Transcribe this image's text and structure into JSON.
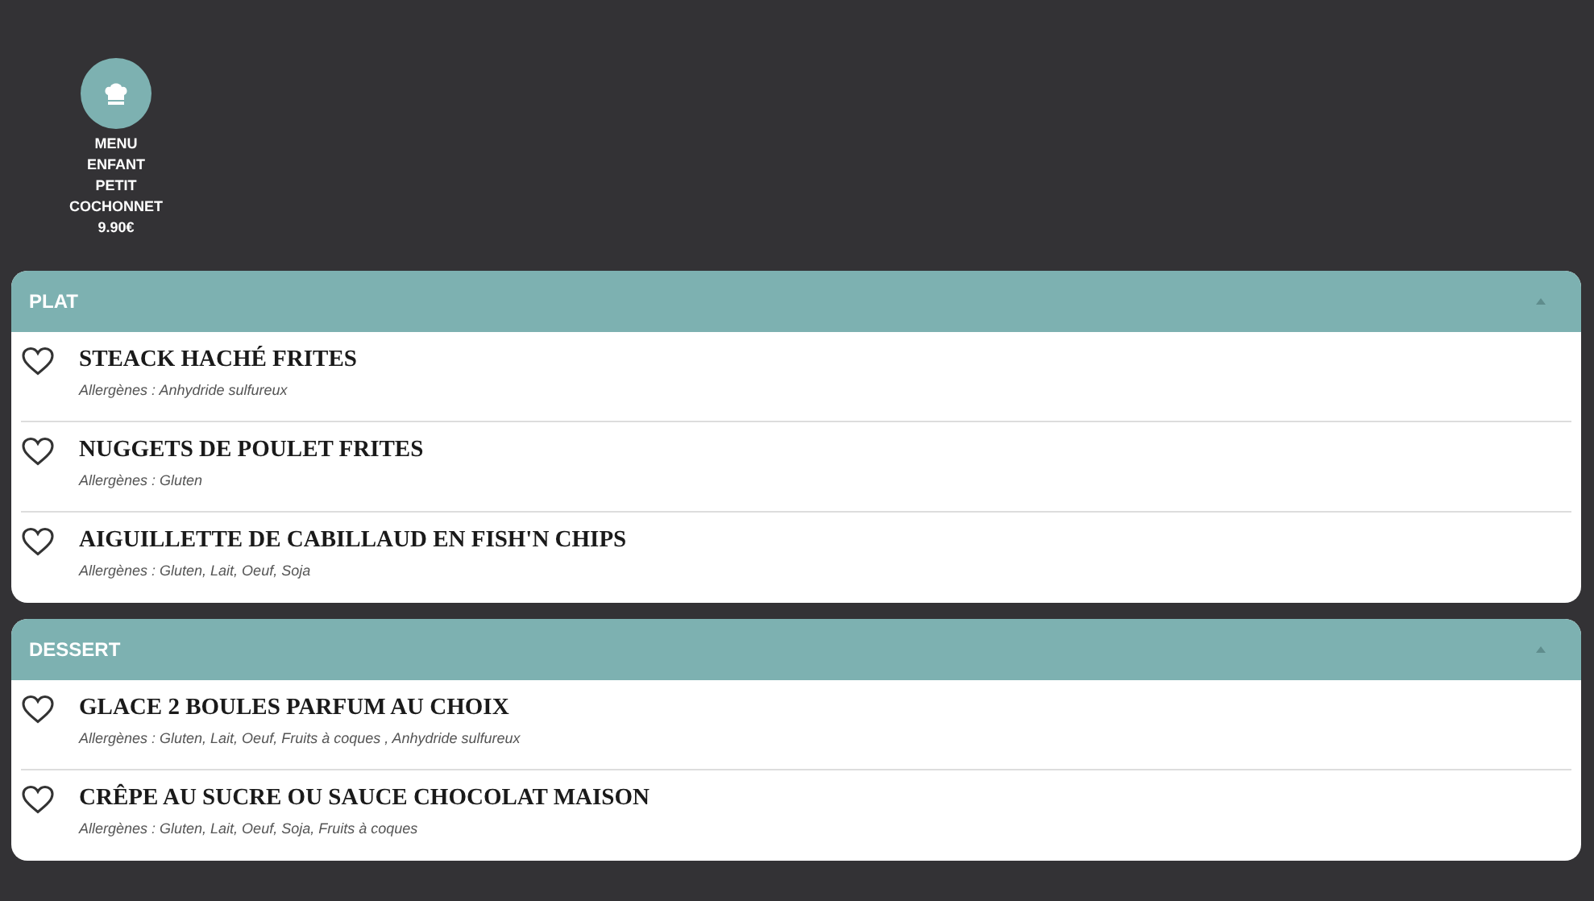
{
  "menu_tile": {
    "lines": [
      "MENU",
      "ENFANT",
      "PETIT",
      "COCHONNET"
    ],
    "price": "9.90€"
  },
  "sections": [
    {
      "title": "PLAT",
      "expanded": true,
      "items": [
        {
          "name": "STEACK HACHÉ FRITES",
          "allergens": "Allergènes : Anhydride sulfureux"
        },
        {
          "name": "NUGGETS DE POULET FRITES",
          "allergens": "Allergènes : Gluten"
        },
        {
          "name": "AIGUILLETTE DE CABILLAUD EN FISH'N CHIPS",
          "allergens": "Allergènes : Gluten, Lait, Oeuf, Soja"
        }
      ]
    },
    {
      "title": "DESSERT",
      "expanded": true,
      "items": [
        {
          "name": "GLACE 2 BOULES PARFUM AU CHOIX",
          "allergens": "Allergènes : Gluten, Lait, Oeuf, Fruits à coques , Anhydride sulfureux"
        },
        {
          "name": "CRÊPE AU SUCRE OU SAUCE CHOCOLAT MAISON",
          "allergens": "Allergènes : Gluten, Lait, Oeuf, Soja, Fruits à coques"
        }
      ]
    }
  ]
}
